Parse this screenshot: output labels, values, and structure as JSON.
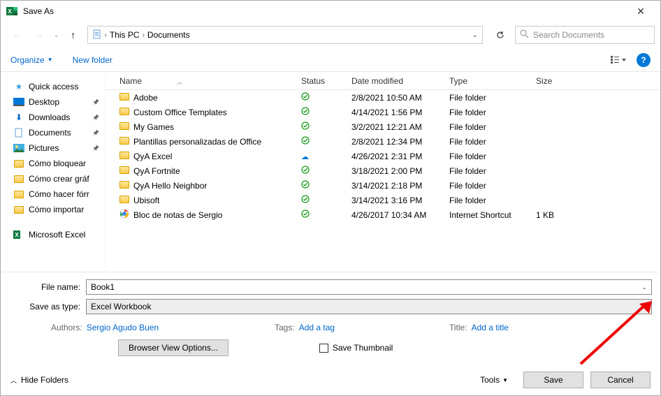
{
  "window": {
    "title": "Save As"
  },
  "breadcrumbs": {
    "root": "This PC",
    "current": "Documents"
  },
  "search": {
    "placeholder": "Search Documents"
  },
  "toolbar": {
    "organize": "Organize",
    "new_folder": "New folder"
  },
  "sidebar": {
    "quick_access": "Quick access",
    "desktop": "Desktop",
    "downloads": "Downloads",
    "documents": "Documents",
    "pictures": "Pictures",
    "folders": [
      "Cómo bloquear",
      "Cómo crear gráf",
      "Cómo hacer fórr",
      "Cómo importar"
    ],
    "excel": "Microsoft Excel"
  },
  "columns": {
    "name": "Name",
    "status": "Status",
    "date": "Date modified",
    "type": "Type",
    "size": "Size"
  },
  "files": [
    {
      "name": "Adobe",
      "status": "synced",
      "date": "2/8/2021 10:50 AM",
      "type": "File folder",
      "size": "",
      "icon": "folder"
    },
    {
      "name": "Custom Office Templates",
      "status": "synced",
      "date": "4/14/2021 1:56 PM",
      "type": "File folder",
      "size": "",
      "icon": "folder"
    },
    {
      "name": "My Games",
      "status": "synced",
      "date": "3/2/2021 12:21 AM",
      "type": "File folder",
      "size": "",
      "icon": "folder"
    },
    {
      "name": "Plantillas personalizadas de Office",
      "status": "synced",
      "date": "2/8/2021 12:34 PM",
      "type": "File folder",
      "size": "",
      "icon": "folder"
    },
    {
      "name": "QyA Excel",
      "status": "cloud",
      "date": "4/26/2021 2:31 PM",
      "type": "File folder",
      "size": "",
      "icon": "folder"
    },
    {
      "name": "QyA Fortnite",
      "status": "synced",
      "date": "3/18/2021 2:00 PM",
      "type": "File folder",
      "size": "",
      "icon": "folder"
    },
    {
      "name": "QyA Hello Neighbor",
      "status": "synced",
      "date": "3/14/2021 2:18 PM",
      "type": "File folder",
      "size": "",
      "icon": "folder"
    },
    {
      "name": "Ubisoft",
      "status": "synced",
      "date": "3/14/2021 3:16 PM",
      "type": "File folder",
      "size": "",
      "icon": "folder"
    },
    {
      "name": "Bloc de notas de Sergio",
      "status": "synced",
      "date": "4/26/2017 10:34 AM",
      "type": "Internet Shortcut",
      "size": "1 KB",
      "icon": "chrome"
    }
  ],
  "form": {
    "file_name_label": "File name:",
    "file_name": "Book1",
    "save_type_label": "Save as type:",
    "save_type": "Excel Workbook",
    "authors_label": "Authors:",
    "authors": "Sergio Agudo Buen",
    "tags_label": "Tags:",
    "tags": "Add a tag",
    "title_label": "Title:",
    "title": "Add a title",
    "browser_opts": "Browser View Options...",
    "save_thumb": "Save Thumbnail"
  },
  "footer": {
    "hide_folders": "Hide Folders",
    "tools": "Tools",
    "save": "Save",
    "cancel": "Cancel"
  }
}
